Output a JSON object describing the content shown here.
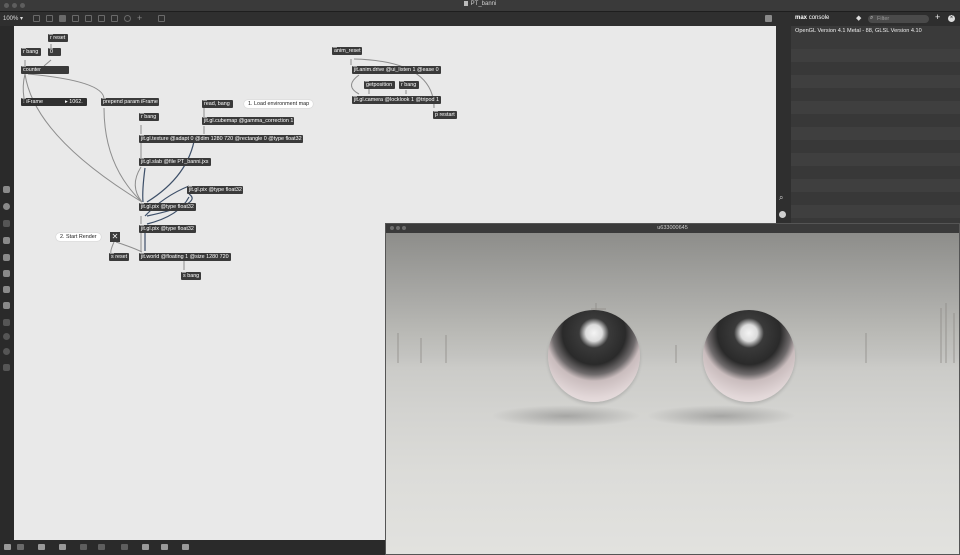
{
  "window": {
    "title": "PT_banni"
  },
  "toolbar": {
    "zoom": "100%"
  },
  "console": {
    "title_bold": "max",
    "title_rest": "console",
    "filter_placeholder": "Filter",
    "lines": [
      "OpenGL Version 4.1 Metal - 88, GLSL Version 4.10"
    ]
  },
  "objects": {
    "r_reset": "r reset",
    "r_bang_left": "r bang",
    "int_zero": "0",
    "counter": "counter",
    "iframe_label": "iFrame",
    "iframe_value": "1062.",
    "prepend": "prepend param iFrame",
    "read_bang": "read, bang",
    "r_bang_mid": "r bang",
    "cubemap": "jit.gl.cubemap @gamma_correction 1",
    "texture": "jit.gl.texture @adapt 0 @dim 1280 720 @rectangle 0 @type float32",
    "slab": "jit.gl.slab @file PT_banni.jxs",
    "pix_right": "jit.gl.pix @type float32",
    "pix_mid": "jit.gl.pix @type float32",
    "pix_low": "jit.gl.pix @type float32",
    "s_reset": "s reset",
    "world": "jit.world @floating 1 @size 1280 720",
    "s_bang": "s bang",
    "anim_reset": "anim_reset",
    "anim_drive": "jit.anim.drive @ui_listen 1 @ease 0",
    "getposition": "getposition",
    "r_bang_right": "r bang",
    "camera": "jit.gl.camera @locklook 1 @tripod 1",
    "p_restart": "p restart"
  },
  "comments": {
    "load_env": "1. Load environment map",
    "start_render": "2. Start Render"
  },
  "render_window": {
    "title": "u633000645"
  },
  "colors": {
    "canvas": "#e9e9e9",
    "object_box": "#3a3a3a",
    "cable": "#8d8d8d",
    "cable_signal": "#3d4f68"
  }
}
